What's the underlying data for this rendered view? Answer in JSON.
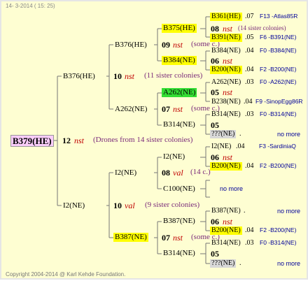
{
  "header": {
    "date": "14-  3-2014 ( 15: 25)"
  },
  "footer": {
    "copyright": "Copyright 2004-2014 @ Karl Kehde Foundation."
  },
  "root": {
    "id": "B379(HE)",
    "gen_num": "12",
    "mate": "nst",
    "note": "(Drones from 14 sister colonies)"
  },
  "g1": [
    {
      "id": "B376(HE)",
      "gen_num": "10",
      "mate": "nst",
      "note": "(11 sister colonies)"
    },
    {
      "id": "I2(NE)",
      "gen_num": "10",
      "mate": "val",
      "note": "(9 sister colonies)"
    }
  ],
  "g2": [
    {
      "id": "B376(HE)",
      "gen_num": "09",
      "mate": "nst",
      "note": "(some c.)"
    },
    {
      "id": "A262(NE)",
      "gen_num": "07",
      "mate": "nst",
      "note": "(some c.)"
    },
    {
      "id": "I2(NE)",
      "gen_num": "08",
      "mate": "val",
      "note": "(14 c.)"
    },
    {
      "id": "B387(NE)",
      "gen_num": "07",
      "mate": "nst",
      "note": "(some c.)"
    }
  ],
  "g3": [
    {
      "id": "B375(HE)"
    },
    {
      "id": "B384(NE)"
    },
    {
      "id": "A262(NE)"
    },
    {
      "id": "B314(NE)"
    },
    {
      "id": "I2(NE)"
    },
    {
      "id": "C100(NE)"
    },
    {
      "id": "B387(NE)"
    },
    {
      "id": "B314(NE)"
    }
  ],
  "g3_mates": [
    {
      "gen_num": "08",
      "mate": "nst",
      "note": "(14 sister colonies)"
    },
    {
      "gen_num": "06",
      "mate": "nst",
      "note": ""
    },
    {
      "gen_num": "05",
      "mate": "nst",
      "note": ""
    },
    {
      "gen_num": "05",
      "mate": "",
      "note": ""
    },
    {
      "gen_num": "06",
      "mate": "nst",
      "note": ""
    },
    {
      "gen_num": "",
      "mate": "",
      "note": ""
    },
    {
      "gen_num": "06",
      "mate": "nst",
      "note": ""
    },
    {
      "gen_num": "05",
      "mate": "",
      "note": ""
    }
  ],
  "g4": [
    {
      "id": "B361(HE)",
      "gen": ".07",
      "line": "F13 -Atlas85R"
    },
    {
      "id": "B391(NE)",
      "gen": ".05",
      "line": "F6 -B391(NE)"
    },
    {
      "id": "B384(NE)",
      "gen": ".04",
      "line": "F0 -B384(NE)"
    },
    {
      "id": "B200(NE)",
      "gen": ".04",
      "line": "F2 -B200(NE)"
    },
    {
      "id": "A262(NE)",
      "gen": ".03",
      "line": "F0 -A262(NE)"
    },
    {
      "id": "B238(NE)",
      "gen": ".04",
      "line": "F9 -SinopEgg86R"
    },
    {
      "id": "B314(NE)",
      "gen": ".03",
      "line": "F0 -B314(NE)"
    },
    {
      "id": "???(NE)",
      "gen": ".",
      "line": "no more"
    },
    {
      "id": "I2(NE)",
      "gen": ".04",
      "line": "F3 -SardiniaQ"
    },
    {
      "id": "B200(NE)",
      "gen": ".04",
      "line": "F2 -B200(NE)"
    },
    {
      "id": "",
      "gen": "",
      "line": "no more"
    },
    {
      "id": "B387(NE)",
      "gen": ".",
      "line": "no more"
    },
    {
      "id": "B200(NE)",
      "gen": ".04",
      "line": "F2 -B200(NE)"
    },
    {
      "id": "B314(NE)",
      "gen": ".03",
      "line": "F0 -B314(NE)"
    },
    {
      "id": "???(NE)",
      "gen": ".",
      "line": "no more"
    }
  ]
}
